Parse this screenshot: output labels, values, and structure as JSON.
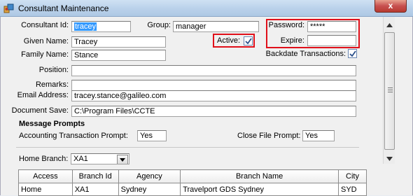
{
  "window": {
    "title": "Consultant Maintenance",
    "close_glyph": "x"
  },
  "fields": {
    "consultant_id": {
      "label": "Consultant Id:",
      "value": "tracey"
    },
    "group": {
      "label": "Group:",
      "value": "manager"
    },
    "password": {
      "label": "Password:",
      "value": "*****"
    },
    "given_name": {
      "label": "Given Name:",
      "value": "Tracey"
    },
    "active": {
      "label": "Active:",
      "checked": true
    },
    "expire": {
      "label": "Expire:",
      "value": ""
    },
    "family_name": {
      "label": "Family Name:",
      "value": "Stance"
    },
    "backdate": {
      "label": "Backdate Transactions:",
      "checked": true
    },
    "position": {
      "label": "Position:",
      "value": ""
    },
    "remarks": {
      "label": "Remarks:",
      "value": ""
    },
    "email": {
      "label": "Email Address:",
      "value": "tracey.stance@galileo.com"
    },
    "document_save": {
      "label": "Document Save:",
      "value": "C:\\Program Files\\CCTE"
    }
  },
  "message_prompts": {
    "title": "Message Prompts",
    "accounting": {
      "label": "Accounting Transaction Prompt:",
      "value": "Yes"
    },
    "close_file": {
      "label": "Close File Prompt:",
      "value": "Yes"
    }
  },
  "home_branch": {
    "label": "Home Branch:",
    "value": "XA1"
  },
  "branch_table": {
    "columns": [
      "Access",
      "Branch Id",
      "Agency",
      "Branch Name",
      "City"
    ],
    "rows": [
      [
        "Home",
        "XA1",
        "Sydney",
        "Travelport GDS Sydney",
        "SYD"
      ]
    ]
  },
  "colors": {
    "highlight_box": "#e0101a",
    "selection": "#3399ff",
    "titlebar": "#b9d1ea"
  }
}
